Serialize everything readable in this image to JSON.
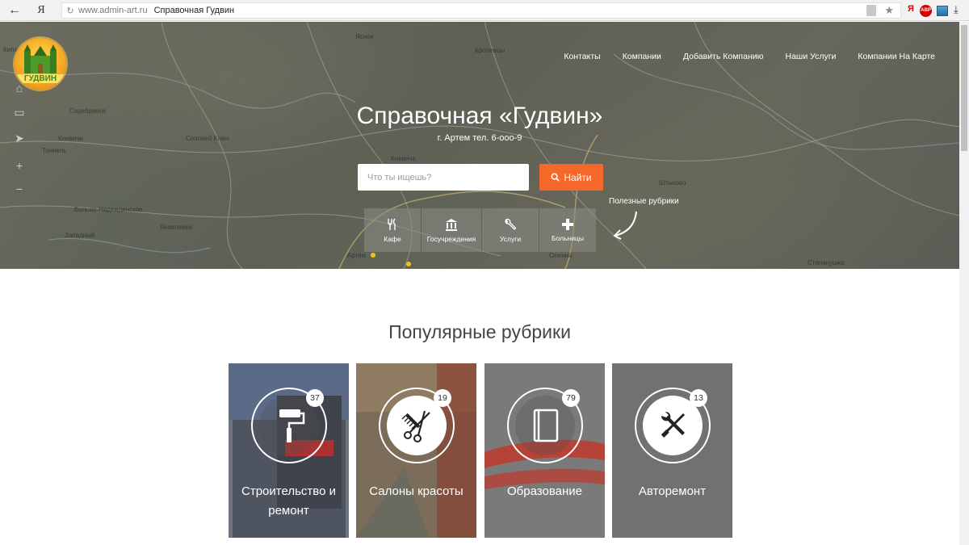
{
  "browser": {
    "back_icon": "back-arrow-icon",
    "yandex_label": "Я",
    "url_domain": "www.admin-art.ru",
    "page_title": "Справочная Гудвин",
    "ext_ya": "Я",
    "ext_abp": "ABP"
  },
  "logo": {
    "text": "ГУДВИН"
  },
  "nav": {
    "items": [
      "Контакты",
      "Компании",
      "Добавить Компанию",
      "Наши Услуги",
      "Компании На Карте"
    ]
  },
  "hero": {
    "title": "Справочная «Гудвин»",
    "subtitle": "г. Артем тел. 6-ооо-9",
    "search_placeholder": "Что ты ищешь?",
    "search_button": "Найти",
    "useful_label": "Полезные рубрики"
  },
  "map_labels": [
    "Ясное",
    "Кролевцы",
    "Серебряное",
    "Кневичи",
    "Соловей Ключ",
    "Тоннель",
    "Кипарисово",
    "Вольно-Надеждинское",
    "Западный",
    "Яковлевка",
    "Кневичи",
    "Штыково",
    "Артем",
    "Олений",
    "Степанушка"
  ],
  "quick_categories": [
    {
      "label": "Кафе",
      "icon": "fork-knife-icon"
    },
    {
      "label": "Госучреждения",
      "icon": "government-building-icon"
    },
    {
      "label": "Услуги",
      "icon": "wrench-icon"
    },
    {
      "label": "Больницы",
      "icon": "medical-cross-icon"
    }
  ],
  "popular": {
    "title": "Популярные рубрики",
    "cards": [
      {
        "label": "Строительство и ремонт",
        "count": "37",
        "icon": "paint-roller-icon"
      },
      {
        "label": "Салоны красоты",
        "count": "19",
        "icon": "scissors-comb-icon"
      },
      {
        "label": "Образование",
        "count": "79",
        "icon": "book-icon"
      },
      {
        "label": "Авторемонт",
        "count": "13",
        "icon": "wrench-screwdriver-icon"
      }
    ]
  },
  "colors": {
    "accent": "#f4682a",
    "card_gray": "#717171"
  }
}
